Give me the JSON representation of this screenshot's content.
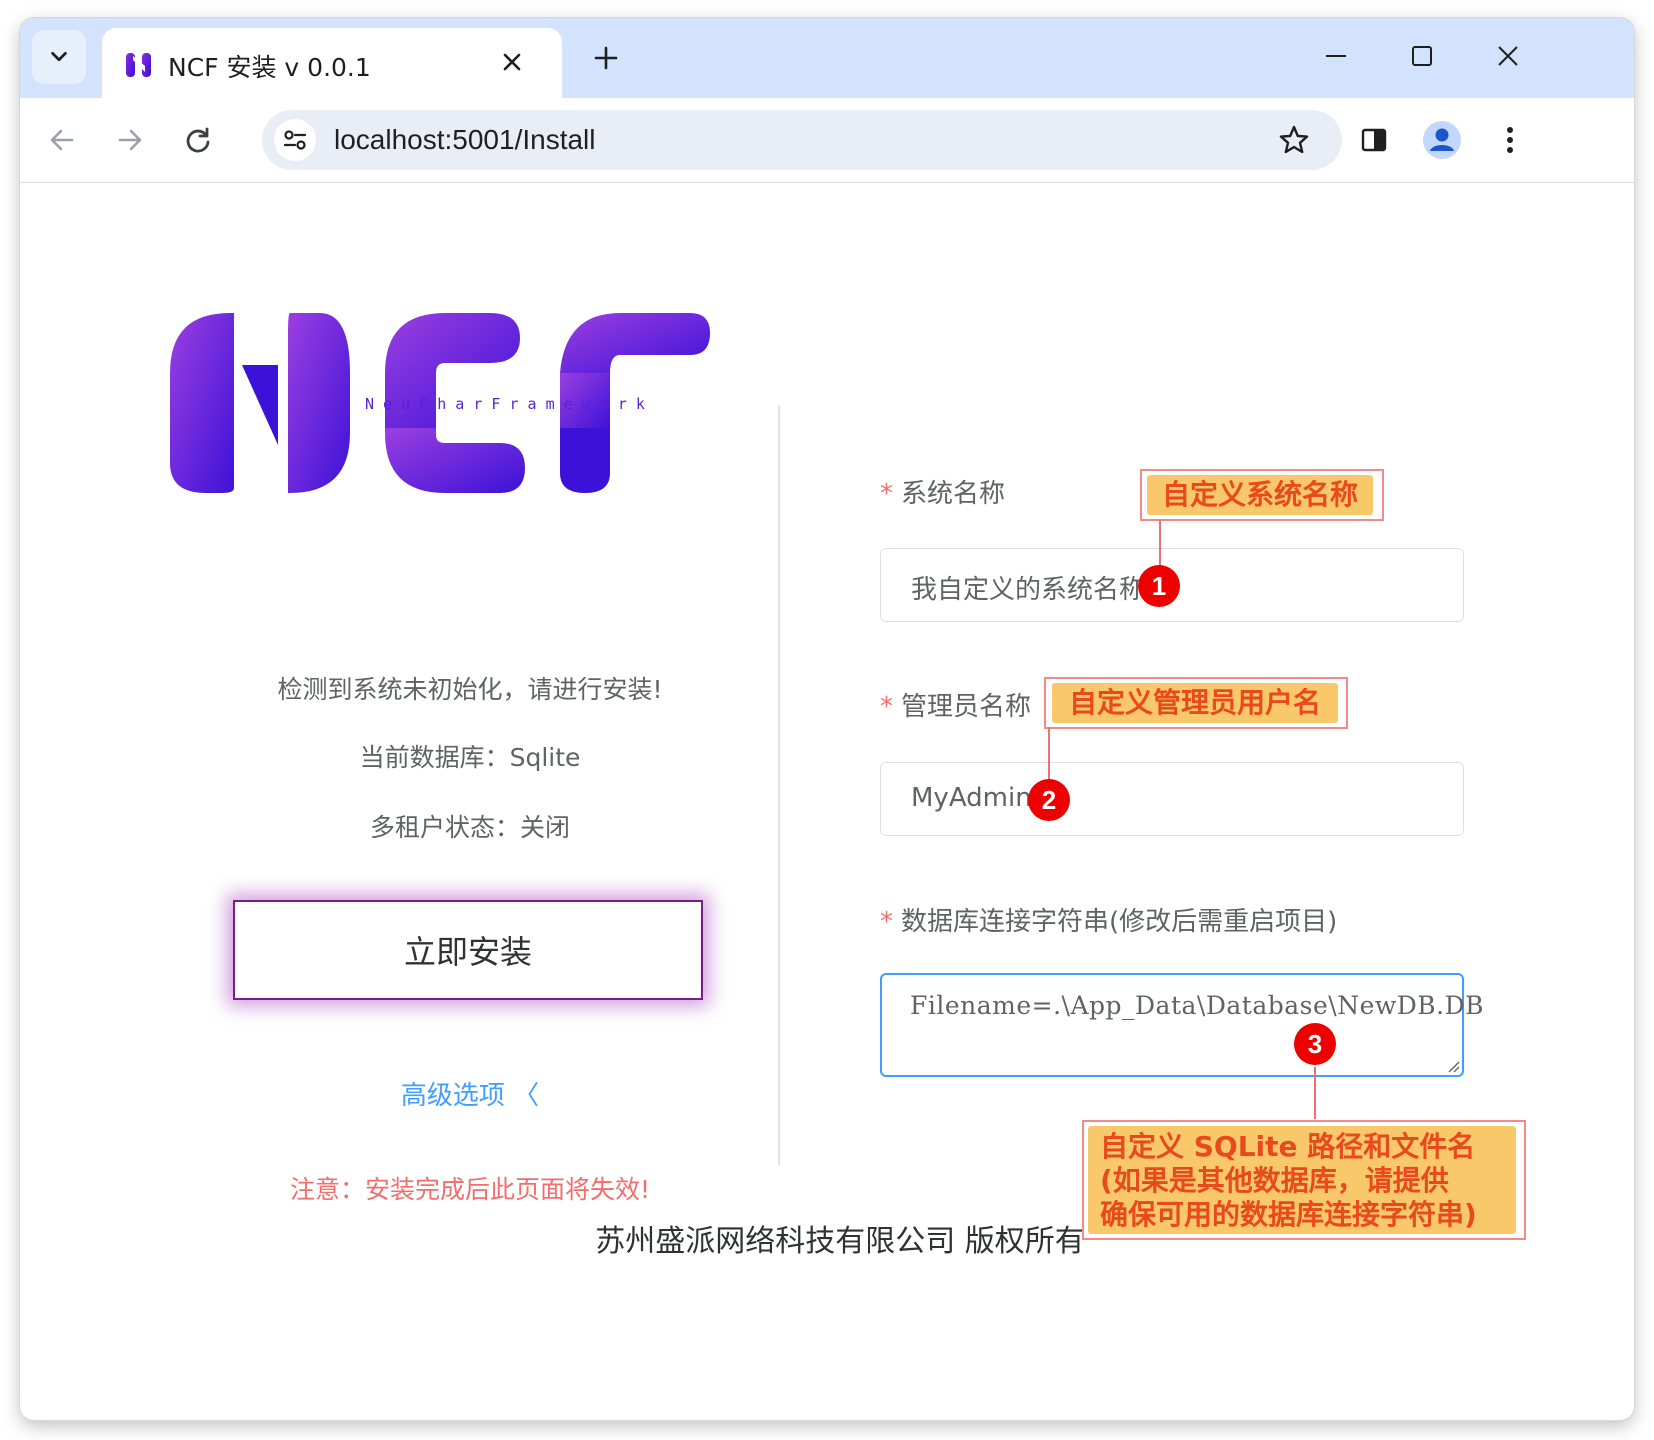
{
  "browser": {
    "tab_title": "NCF 安装 v 0.0.1",
    "url": "localhost:5001/Install"
  },
  "logo": {
    "tagline": "N e u C h a r F r a m e w o r k"
  },
  "left_panel": {
    "status_message": "检测到系统未初始化，请进行安装!",
    "database_line": "当前数据库：Sqlite",
    "tenant_line": "多租户状态：关闭",
    "install_button": "立即安装",
    "advanced_options": "高级选项 〈",
    "notice": "注意：安装完成后此页面将失效!"
  },
  "form": {
    "system_name": {
      "label": "系统名称",
      "value": "我自定义的系统名称"
    },
    "admin_name": {
      "label": "管理员名称",
      "value": "MyAdmin"
    },
    "connection_string": {
      "label": "数据库连接字符串(修改后需重启项目)",
      "value": "Filename=.\\App_Data\\Database\\NewDB.DB"
    }
  },
  "footer": {
    "copyright": "苏州盛派网络科技有限公司 版权所有"
  },
  "annotations": {
    "callout_1": "自定义系统名称",
    "callout_2": "自定义管理员用户名",
    "callout_3_line1": "自定义 SQLite 路径和文件名",
    "callout_3_line2": "(如果是其他数据库，请提供",
    "callout_3_line3": "确保可用的数据库连接字符串)",
    "badge_1": "1",
    "badge_2": "2",
    "badge_3": "3"
  },
  "colors": {
    "accent_purple": "#5a1fd6",
    "link_blue": "#409eff",
    "danger_red": "#f56c6c",
    "callout_fill": "#f9c86b",
    "badge_red": "#ee0000"
  }
}
